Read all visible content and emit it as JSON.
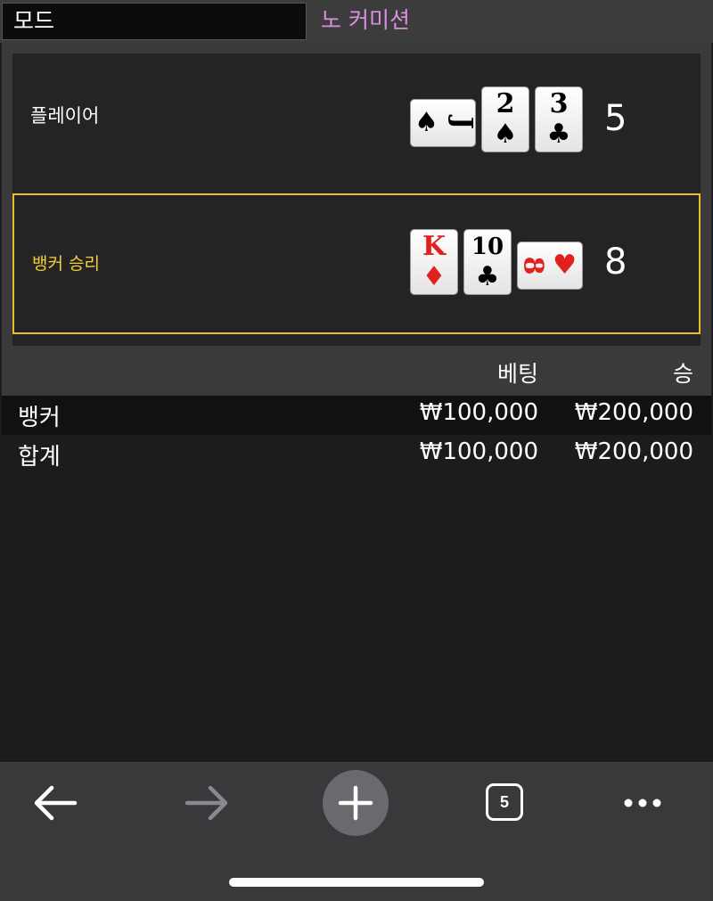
{
  "mode": {
    "label": "모드",
    "value": "노 커미션"
  },
  "player": {
    "label": "플레이어",
    "score": "5",
    "cards": [
      {
        "rank": "J",
        "suit": "♠",
        "color": "black",
        "orientation": "sideways"
      },
      {
        "rank": "2",
        "suit": "♠",
        "color": "black",
        "orientation": "upright"
      },
      {
        "rank": "3",
        "suit": "♣",
        "color": "black",
        "orientation": "upright"
      }
    ]
  },
  "banker": {
    "label": "뱅커 승리",
    "score": "8",
    "cards": [
      {
        "rank": "K",
        "suit": "♦",
        "color": "red",
        "orientation": "upright"
      },
      {
        "rank": "10",
        "suit": "♣",
        "color": "black",
        "orientation": "upright"
      },
      {
        "rank": "8",
        "suit": "♥",
        "color": "red",
        "orientation": "sideways"
      }
    ]
  },
  "bets": {
    "headers": {
      "bet": "베팅",
      "win": "승"
    },
    "rows": [
      {
        "name": "뱅커",
        "bet": "₩100,000",
        "win": "₩200,000"
      }
    ],
    "total": {
      "name": "합계",
      "bet": "₩100,000",
      "win": "₩200,000"
    }
  },
  "toolbar": {
    "back_icon": "back-arrow-icon",
    "forward_icon": "forward-arrow-icon",
    "new_tab_icon": "plus-icon",
    "tab_count": "5",
    "more_icon": "more-dots-icon"
  },
  "colors": {
    "mode_value": "#d98ee0",
    "banker_highlight": "#e2c12d",
    "card_red": "#e2201c"
  }
}
